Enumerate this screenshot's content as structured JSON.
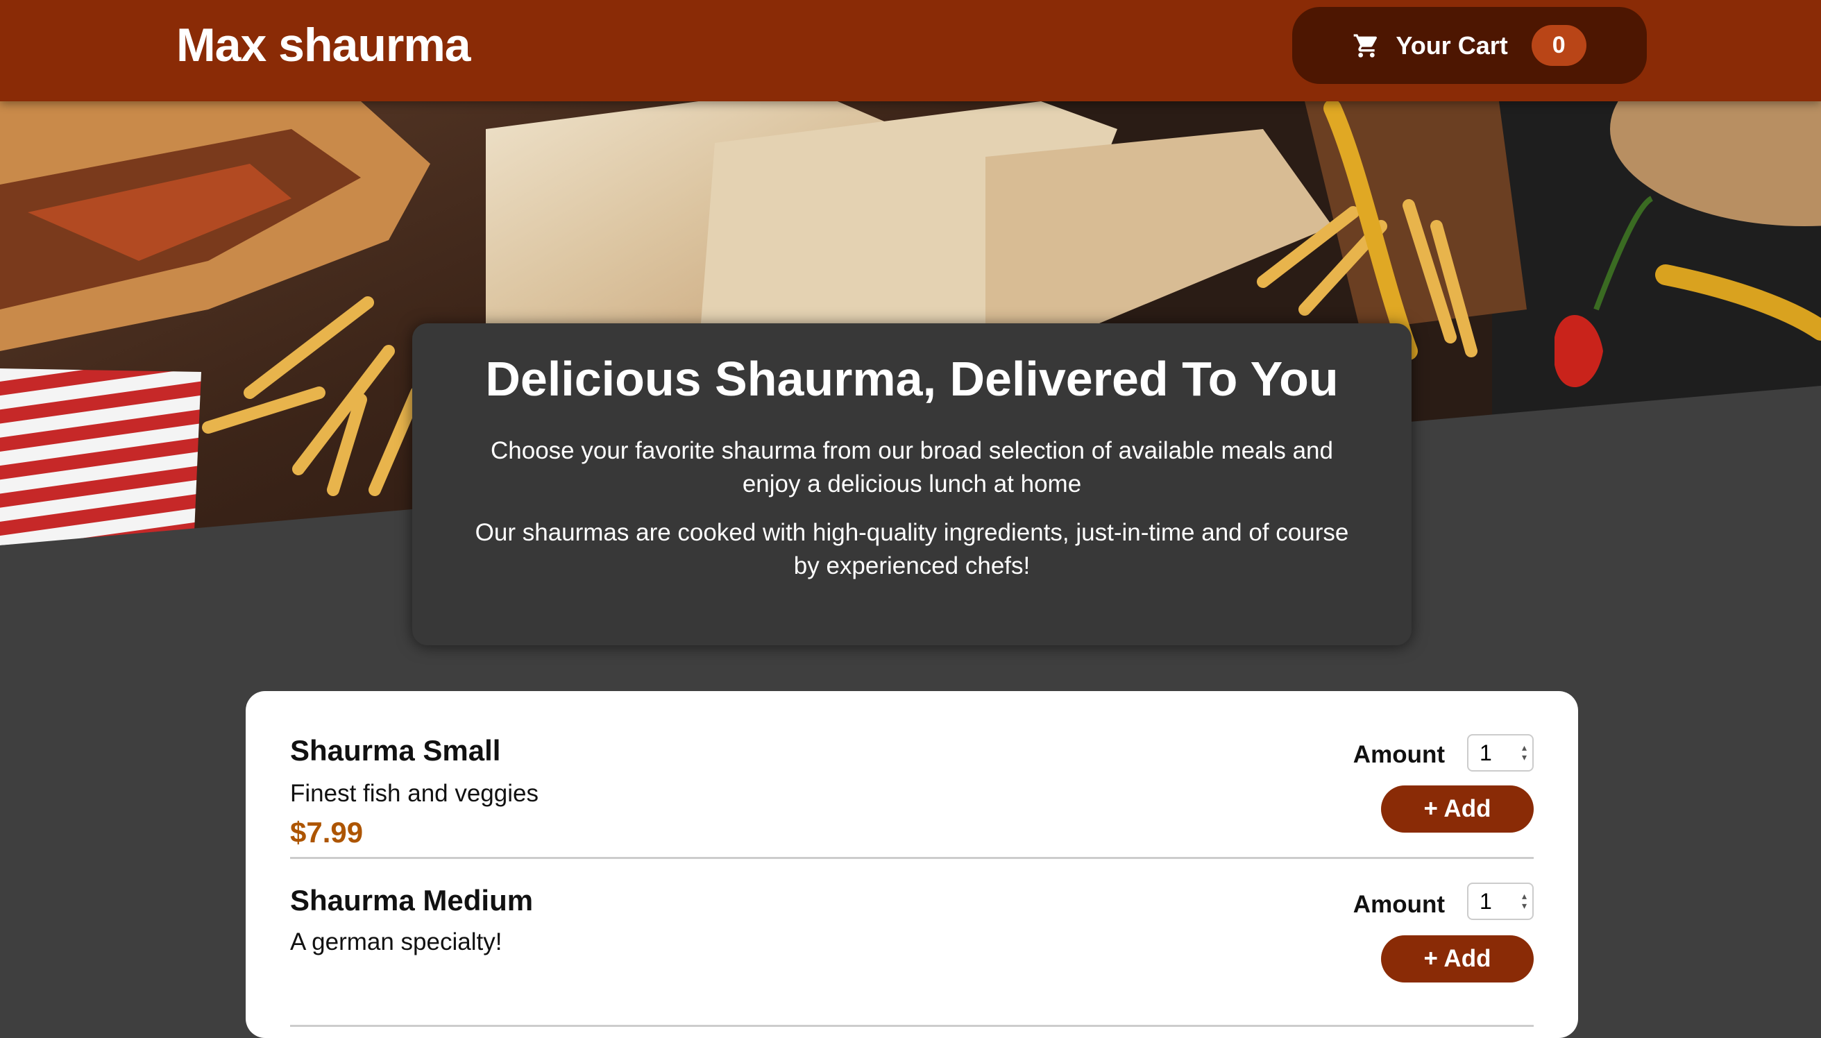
{
  "header": {
    "title": "Max shaurma",
    "cart": {
      "label": "Your Cart",
      "count": "0",
      "icon": "cart-icon"
    }
  },
  "summary": {
    "heading": "Delicious Shaurma, Delivered To You",
    "paragraph1": "Choose your favorite shaurma from our broad selection of available meals and enjoy a delicious lunch at home",
    "paragraph2": "Our shaurmas are cooked with high-quality ingredients, just-in-time and of course by experienced chefs!"
  },
  "meals": [
    {
      "name": "Shaurma Small",
      "description": "Finest fish and veggies",
      "price": "$7.99",
      "amount_label": "Amount",
      "amount": "1",
      "add_label": "+ Add"
    },
    {
      "name": "Shaurma Medium",
      "description": "A german specialty!",
      "price": "",
      "amount_label": "Amount",
      "amount": "1",
      "add_label": "+ Add"
    }
  ],
  "colors": {
    "header": "#8a2b06",
    "cart_button": "#4d1601",
    "cart_badge": "#b94517",
    "price": "#ad5502",
    "background": "#3f3f3f"
  }
}
